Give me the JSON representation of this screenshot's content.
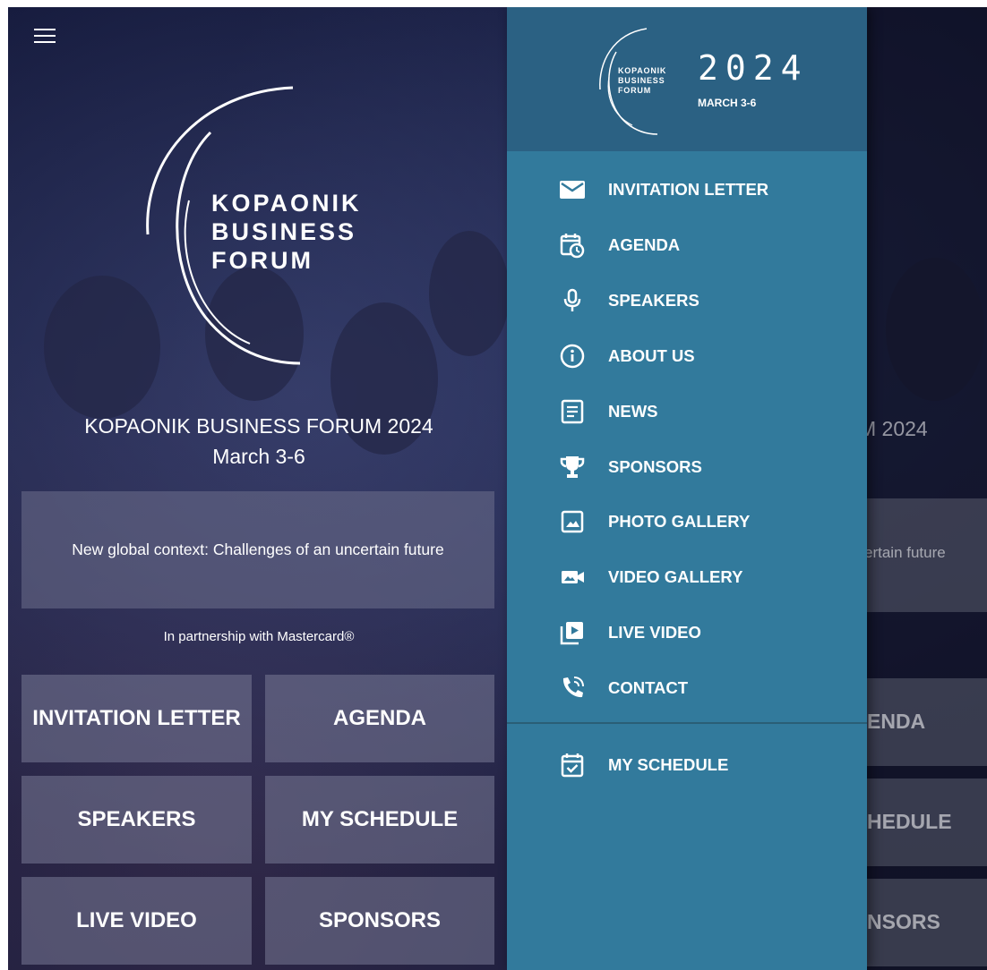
{
  "hero": {
    "logo_words": [
      "KOPAONIK",
      "BUSINESS",
      "FORUM"
    ],
    "title": "KOPAONIK BUSINESS FORUM 2024",
    "dates": "March 3-6",
    "theme": "New global context: Challenges of an uncertain future",
    "partnership": "In partnership with Mastercard®"
  },
  "tiles": [
    {
      "label": "INVITATION LETTER"
    },
    {
      "label": "AGENDA"
    },
    {
      "label": "SPEAKERS"
    },
    {
      "label": "MY SCHEDULE"
    },
    {
      "label": "LIVE VIDEO"
    },
    {
      "label": "SPONSORS"
    }
  ],
  "background_peek": {
    "title_fragment": "M 2024",
    "theme_fragment": "ertain future",
    "tile_fragments": [
      "ENDA",
      "HEDULE",
      "NSORS"
    ]
  },
  "drawer": {
    "logo_words": [
      "KOPAONIK",
      "BUSINESS",
      "FORUM"
    ],
    "year": "2024",
    "dates": "MARCH 3-6",
    "items": [
      {
        "label": "INVITATION LETTER",
        "icon": "envelope-icon"
      },
      {
        "label": "AGENDA",
        "icon": "calendar-clock-icon"
      },
      {
        "label": "SPEAKERS",
        "icon": "microphone-icon"
      },
      {
        "label": "ABOUT US",
        "icon": "info-icon"
      },
      {
        "label": "NEWS",
        "icon": "news-icon"
      },
      {
        "label": "SPONSORS",
        "icon": "trophy-icon"
      },
      {
        "label": "PHOTO GALLERY",
        "icon": "photo-icon"
      },
      {
        "label": "VIDEO GALLERY",
        "icon": "video-camera-icon"
      },
      {
        "label": "LIVE VIDEO",
        "icon": "play-library-icon"
      },
      {
        "label": "CONTACT",
        "icon": "phone-icon"
      }
    ],
    "secondary_items": [
      {
        "label": "MY SCHEDULE",
        "icon": "calendar-check-icon"
      }
    ]
  },
  "colors": {
    "drawer_bg": "#327a9c",
    "drawer_header_bg": "#2b6183",
    "hero_bg": "#1d2247",
    "tile_bg": "#787a96"
  }
}
